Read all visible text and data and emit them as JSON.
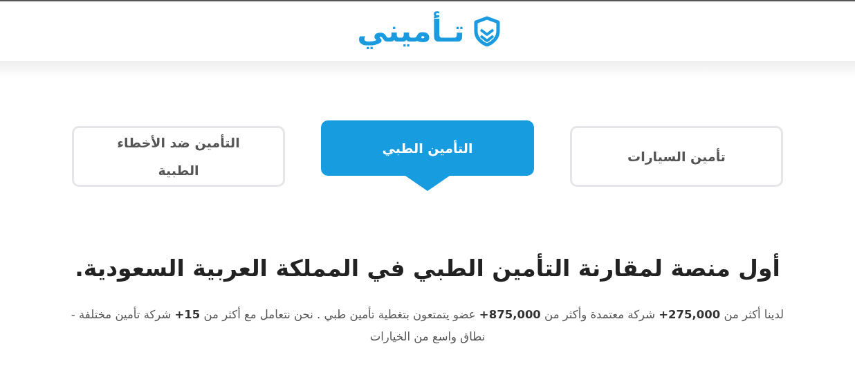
{
  "header": {
    "logo_text": "تـأميني"
  },
  "tabs": [
    {
      "label": "تأمين السيارات",
      "selected": false
    },
    {
      "label": "التأمين الطبي",
      "selected": true
    },
    {
      "label": "التأمين ضد الأخطاء الطبية",
      "selected": false
    }
  ],
  "headline": "أول منصة لمقارنة التأمين الطبي في المملكة العربية السعودية.",
  "description": "لدينا أكثر من **275,000+** شركة معتمدة وأكثر من **875,000+** عضو يتمتعون بتغطية تأمين طبي . نحن نتعامل مع أكثر من **15+** شركة تأمين مختلفة - نطاق واسع من الخيارات"
}
